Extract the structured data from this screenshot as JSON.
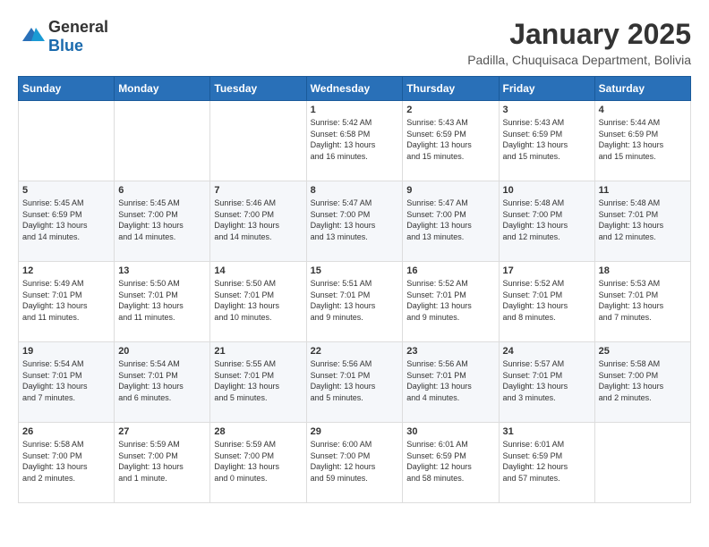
{
  "logo": {
    "general": "General",
    "blue": "Blue"
  },
  "title": "January 2025",
  "location": "Padilla, Chuquisaca Department, Bolivia",
  "weekdays": [
    "Sunday",
    "Monday",
    "Tuesday",
    "Wednesday",
    "Thursday",
    "Friday",
    "Saturday"
  ],
  "weeks": [
    [
      {
        "day": "",
        "info": ""
      },
      {
        "day": "",
        "info": ""
      },
      {
        "day": "",
        "info": ""
      },
      {
        "day": "1",
        "info": "Sunrise: 5:42 AM\nSunset: 6:58 PM\nDaylight: 13 hours\nand 16 minutes."
      },
      {
        "day": "2",
        "info": "Sunrise: 5:43 AM\nSunset: 6:59 PM\nDaylight: 13 hours\nand 15 minutes."
      },
      {
        "day": "3",
        "info": "Sunrise: 5:43 AM\nSunset: 6:59 PM\nDaylight: 13 hours\nand 15 minutes."
      },
      {
        "day": "4",
        "info": "Sunrise: 5:44 AM\nSunset: 6:59 PM\nDaylight: 13 hours\nand 15 minutes."
      }
    ],
    [
      {
        "day": "5",
        "info": "Sunrise: 5:45 AM\nSunset: 6:59 PM\nDaylight: 13 hours\nand 14 minutes."
      },
      {
        "day": "6",
        "info": "Sunrise: 5:45 AM\nSunset: 7:00 PM\nDaylight: 13 hours\nand 14 minutes."
      },
      {
        "day": "7",
        "info": "Sunrise: 5:46 AM\nSunset: 7:00 PM\nDaylight: 13 hours\nand 14 minutes."
      },
      {
        "day": "8",
        "info": "Sunrise: 5:47 AM\nSunset: 7:00 PM\nDaylight: 13 hours\nand 13 minutes."
      },
      {
        "day": "9",
        "info": "Sunrise: 5:47 AM\nSunset: 7:00 PM\nDaylight: 13 hours\nand 13 minutes."
      },
      {
        "day": "10",
        "info": "Sunrise: 5:48 AM\nSunset: 7:00 PM\nDaylight: 13 hours\nand 12 minutes."
      },
      {
        "day": "11",
        "info": "Sunrise: 5:48 AM\nSunset: 7:01 PM\nDaylight: 13 hours\nand 12 minutes."
      }
    ],
    [
      {
        "day": "12",
        "info": "Sunrise: 5:49 AM\nSunset: 7:01 PM\nDaylight: 13 hours\nand 11 minutes."
      },
      {
        "day": "13",
        "info": "Sunrise: 5:50 AM\nSunset: 7:01 PM\nDaylight: 13 hours\nand 11 minutes."
      },
      {
        "day": "14",
        "info": "Sunrise: 5:50 AM\nSunset: 7:01 PM\nDaylight: 13 hours\nand 10 minutes."
      },
      {
        "day": "15",
        "info": "Sunrise: 5:51 AM\nSunset: 7:01 PM\nDaylight: 13 hours\nand 9 minutes."
      },
      {
        "day": "16",
        "info": "Sunrise: 5:52 AM\nSunset: 7:01 PM\nDaylight: 13 hours\nand 9 minutes."
      },
      {
        "day": "17",
        "info": "Sunrise: 5:52 AM\nSunset: 7:01 PM\nDaylight: 13 hours\nand 8 minutes."
      },
      {
        "day": "18",
        "info": "Sunrise: 5:53 AM\nSunset: 7:01 PM\nDaylight: 13 hours\nand 7 minutes."
      }
    ],
    [
      {
        "day": "19",
        "info": "Sunrise: 5:54 AM\nSunset: 7:01 PM\nDaylight: 13 hours\nand 7 minutes."
      },
      {
        "day": "20",
        "info": "Sunrise: 5:54 AM\nSunset: 7:01 PM\nDaylight: 13 hours\nand 6 minutes."
      },
      {
        "day": "21",
        "info": "Sunrise: 5:55 AM\nSunset: 7:01 PM\nDaylight: 13 hours\nand 5 minutes."
      },
      {
        "day": "22",
        "info": "Sunrise: 5:56 AM\nSunset: 7:01 PM\nDaylight: 13 hours\nand 5 minutes."
      },
      {
        "day": "23",
        "info": "Sunrise: 5:56 AM\nSunset: 7:01 PM\nDaylight: 13 hours\nand 4 minutes."
      },
      {
        "day": "24",
        "info": "Sunrise: 5:57 AM\nSunset: 7:01 PM\nDaylight: 13 hours\nand 3 minutes."
      },
      {
        "day": "25",
        "info": "Sunrise: 5:58 AM\nSunset: 7:00 PM\nDaylight: 13 hours\nand 2 minutes."
      }
    ],
    [
      {
        "day": "26",
        "info": "Sunrise: 5:58 AM\nSunset: 7:00 PM\nDaylight: 13 hours\nand 2 minutes."
      },
      {
        "day": "27",
        "info": "Sunrise: 5:59 AM\nSunset: 7:00 PM\nDaylight: 13 hours\nand 1 minute."
      },
      {
        "day": "28",
        "info": "Sunrise: 5:59 AM\nSunset: 7:00 PM\nDaylight: 13 hours\nand 0 minutes."
      },
      {
        "day": "29",
        "info": "Sunrise: 6:00 AM\nSunset: 7:00 PM\nDaylight: 12 hours\nand 59 minutes."
      },
      {
        "day": "30",
        "info": "Sunrise: 6:01 AM\nSunset: 6:59 PM\nDaylight: 12 hours\nand 58 minutes."
      },
      {
        "day": "31",
        "info": "Sunrise: 6:01 AM\nSunset: 6:59 PM\nDaylight: 12 hours\nand 57 minutes."
      },
      {
        "day": "",
        "info": ""
      }
    ]
  ]
}
